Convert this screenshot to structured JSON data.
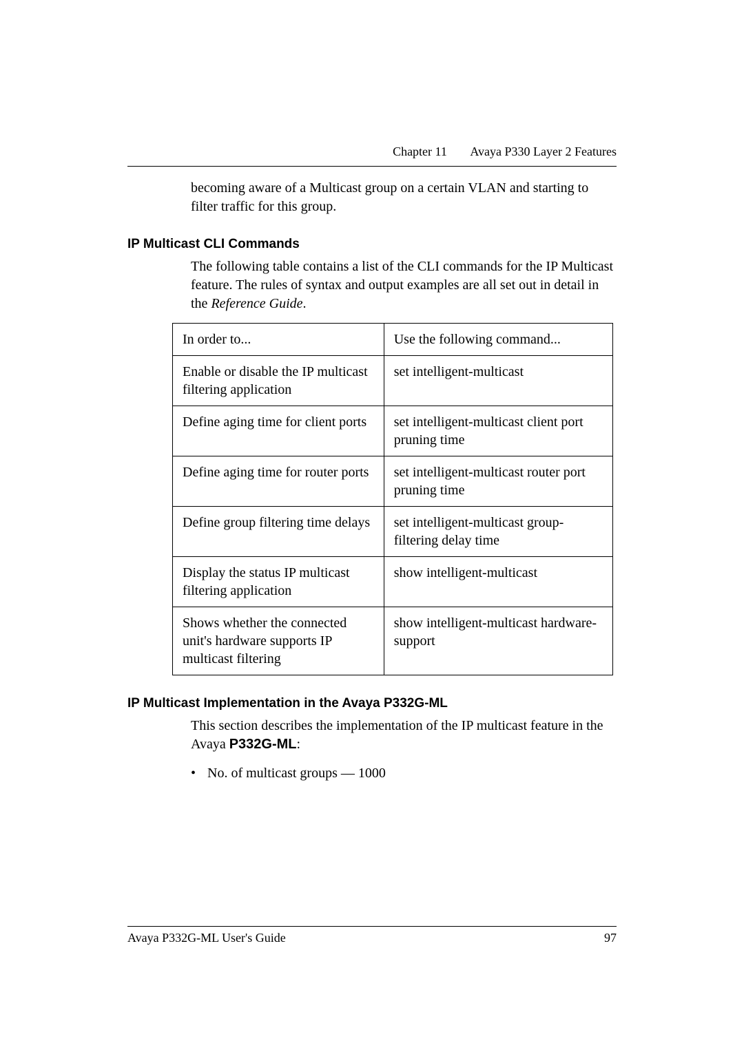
{
  "header": {
    "chapter": "Chapter 11",
    "title": "Avaya P330 Layer 2 Features"
  },
  "continuation": "becoming aware of a Multicast group on a certain VLAN and starting to filter traffic for this group.",
  "section1": {
    "heading": "IP Multicast CLI Commands",
    "para_before_italic": "The following table contains a list of the CLI commands for the IP Multicast feature. The rules of syntax and output examples are all set out in detail in the ",
    "italic": "Reference Guide",
    "para_after_italic": "."
  },
  "table": {
    "headers": {
      "left": "In order to...",
      "right": "Use the following command..."
    },
    "rows": [
      {
        "left": "Enable or disable the IP multicast filtering application",
        "right": "set intelligent-multicast"
      },
      {
        "left": "Define aging time for client ports",
        "right": "set intelligent-multicast client port pruning time"
      },
      {
        "left": "Define aging time for router ports",
        "right": "set intelligent-multicast router port pruning time"
      },
      {
        "left": "Define group filtering time delays",
        "right": "set intelligent-multicast group-filtering delay time"
      },
      {
        "left": "Display the status IP multicast filtering application",
        "right": "show intelligent-multicast"
      },
      {
        "left": "Shows whether the connected unit's hardware supports IP multicast filtering",
        "right": "show intelligent-multicast hardware-support"
      }
    ]
  },
  "section2": {
    "heading": "IP Multicast Implementation in the Avaya P332G-ML",
    "para_before_bold": "This section describes the implementation of the IP multicast feature in the Avaya ",
    "bold": "P332G-ML",
    "para_after_bold": ":",
    "bullet": "No. of multicast groups — 1000"
  },
  "footer": {
    "left": "Avaya P332G-ML User's Guide",
    "right": "97"
  }
}
